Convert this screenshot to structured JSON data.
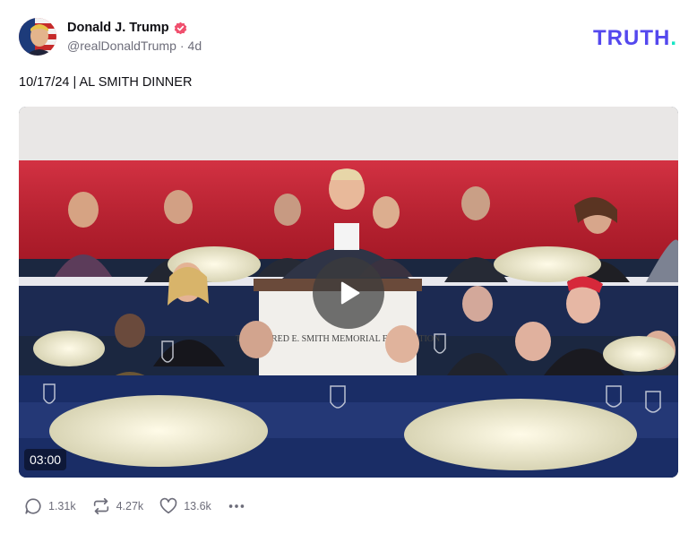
{
  "post": {
    "display_name": "Donald J. Trump",
    "handle": "@realDonaldTrump",
    "separator": "·",
    "age": "4d",
    "text": "10/17/24 | AL SMITH DINNER"
  },
  "brand": {
    "name": "TRUTH",
    "dot": ".",
    "color": "#5448ee",
    "dot_color": "#17e5c4"
  },
  "video": {
    "duration": "03:00",
    "banner_text": "THE ALFRED E. SMITH MEMORIAL FOUNDATION"
  },
  "actions": {
    "replies": "1.31k",
    "retruths": "4.27k",
    "likes": "13.6k"
  },
  "icons": {
    "verified": "verified-badge-icon",
    "reply": "speech-bubble-icon",
    "retruth": "repost-arrows-icon",
    "like": "heart-icon",
    "more": "ellipsis-icon",
    "play": "play-icon"
  },
  "colors": {
    "verified": "#f0506e",
    "muted": "#6d6d7a"
  }
}
